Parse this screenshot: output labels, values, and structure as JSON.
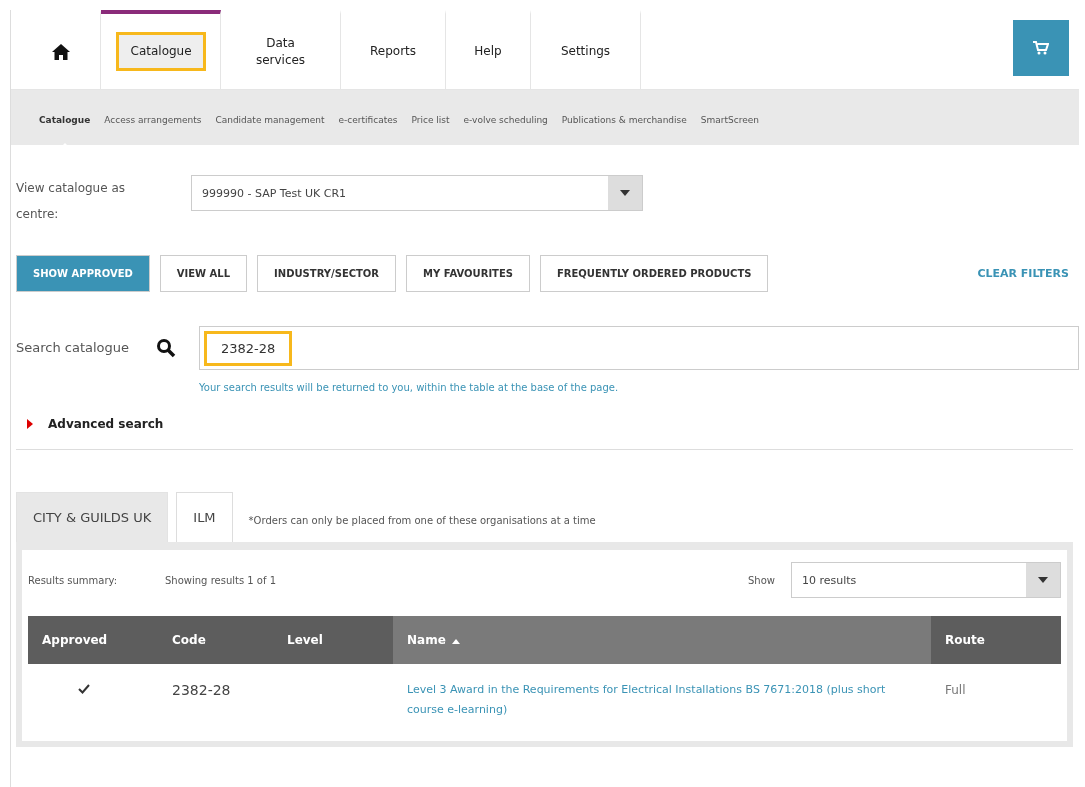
{
  "nav": {
    "items": [
      {
        "kind": "home",
        "selected": false
      },
      {
        "kind": "text",
        "label": "Catalogue",
        "selected": true,
        "highlighted": true
      },
      {
        "kind": "text",
        "label": "Data services",
        "selected": false,
        "highlighted": false
      },
      {
        "kind": "text",
        "label": "Reports",
        "selected": false,
        "highlighted": false
      },
      {
        "kind": "text",
        "label": "Help",
        "selected": false,
        "highlighted": false
      },
      {
        "kind": "text",
        "label": "Settings",
        "selected": false,
        "highlighted": false
      }
    ]
  },
  "subnav": [
    {
      "label": "Catalogue",
      "selected": true
    },
    {
      "label": "Access arrangements",
      "selected": false
    },
    {
      "label": "Candidate management",
      "selected": false
    },
    {
      "label": "e-certificates",
      "selected": false
    },
    {
      "label": "Price list",
      "selected": false
    },
    {
      "label": "e-volve scheduling",
      "selected": false
    },
    {
      "label": "Publications & merchandise",
      "selected": false
    },
    {
      "label": "SmartScreen",
      "selected": false
    }
  ],
  "centre": {
    "label": "View catalogue as centre:",
    "value": "999990 - SAP Test UK CR1"
  },
  "filters": [
    {
      "label": "SHOW APPROVED",
      "selected": true
    },
    {
      "label": "VIEW ALL",
      "selected": false
    },
    {
      "label": "INDUSTRY/SECTOR",
      "selected": false
    },
    {
      "label": "MY FAVOURITES",
      "selected": false
    },
    {
      "label": "FREQUENTLY ORDERED PRODUCTS",
      "selected": false
    }
  ],
  "clear_filters": "CLEAR FILTERS",
  "search": {
    "label": "Search catalogue",
    "value": "2382-28",
    "highlighted": true,
    "hint": "Your search results will be returned to you, within the table at the base of the page."
  },
  "advanced_search": {
    "label": "Advanced search",
    "expanded": false
  },
  "org_tabs": [
    {
      "label": "CITY & GUILDS UK",
      "selected": true
    },
    {
      "label": "ILM",
      "selected": false
    }
  ],
  "org_note": "*Orders can only be placed from one of these organisations at a time",
  "results": {
    "summary_label": "Results summary:",
    "summary": "Showing results 1 of 1",
    "show_label": "Show",
    "show_value": "10 results"
  },
  "table": {
    "columns": [
      {
        "label": "Approved",
        "sorted": false
      },
      {
        "label": "Code",
        "sorted": false
      },
      {
        "label": "Level",
        "sorted": false
      },
      {
        "label": "Name",
        "sorted": true
      },
      {
        "label": "Route",
        "sorted": false
      }
    ],
    "rows": [
      {
        "approved": true,
        "code": "2382-28",
        "name": "Level 3 Award in the Requirements for Electrical Installations BS 7671:2018 (plus short course e-learning)",
        "route": "Full"
      }
    ]
  }
}
